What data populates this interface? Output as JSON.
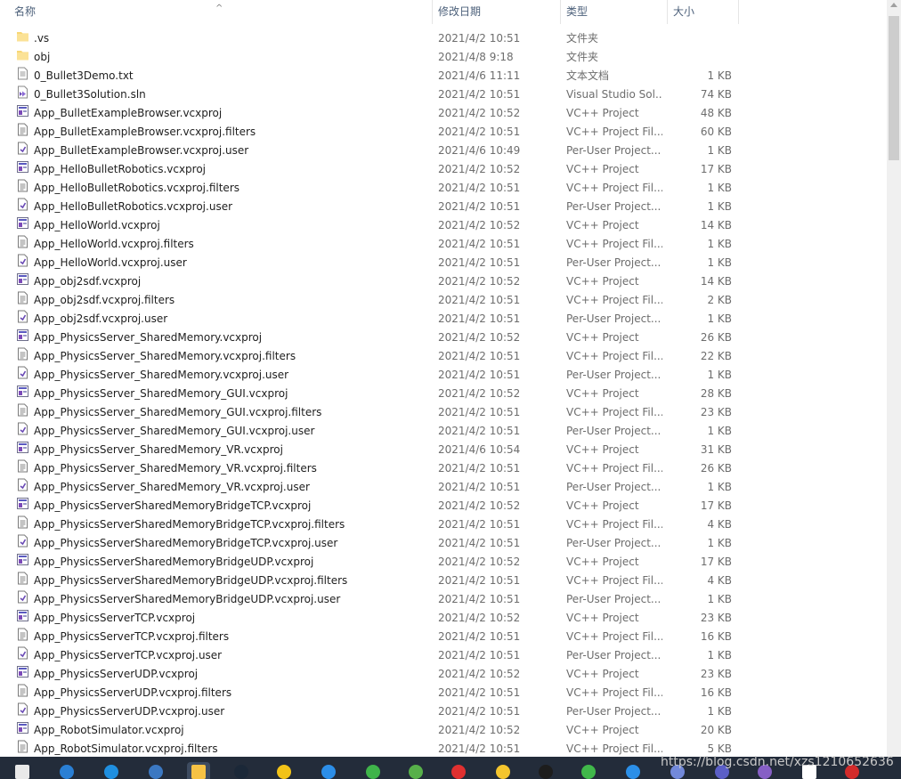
{
  "columns": {
    "name": "名称",
    "date": "修改日期",
    "type": "类型",
    "size": "大小"
  },
  "files": [
    {
      "name": ".vs",
      "date": "2021/4/2 10:51",
      "type": "文件夹",
      "size": "",
      "icon": "folder-icon"
    },
    {
      "name": "obj",
      "date": "2021/4/8 9:18",
      "type": "文件夹",
      "size": "",
      "icon": "folder-icon"
    },
    {
      "name": "0_Bullet3Demo.txt",
      "date": "2021/4/6 11:11",
      "type": "文本文档",
      "size": "1 KB",
      "icon": "text-file-icon"
    },
    {
      "name": "0_Bullet3Solution.sln",
      "date": "2021/4/2 10:51",
      "type": "Visual Studio Sol...",
      "size": "74 KB",
      "icon": "solution-file-icon"
    },
    {
      "name": "App_BulletExampleBrowser.vcxproj",
      "date": "2021/4/2 10:52",
      "type": "VC++ Project",
      "size": "48 KB",
      "icon": "vcxproj-file-icon"
    },
    {
      "name": "App_BulletExampleBrowser.vcxproj.filters",
      "date": "2021/4/2 10:51",
      "type": "VC++ Project Fil...",
      "size": "60 KB",
      "icon": "filters-file-icon"
    },
    {
      "name": "App_BulletExampleBrowser.vcxproj.user",
      "date": "2021/4/6 10:49",
      "type": "Per-User Project...",
      "size": "1 KB",
      "icon": "user-file-icon"
    },
    {
      "name": "App_HelloBulletRobotics.vcxproj",
      "date": "2021/4/2 10:52",
      "type": "VC++ Project",
      "size": "17 KB",
      "icon": "vcxproj-file-icon"
    },
    {
      "name": "App_HelloBulletRobotics.vcxproj.filters",
      "date": "2021/4/2 10:51",
      "type": "VC++ Project Fil...",
      "size": "1 KB",
      "icon": "filters-file-icon"
    },
    {
      "name": "App_HelloBulletRobotics.vcxproj.user",
      "date": "2021/4/2 10:51",
      "type": "Per-User Project...",
      "size": "1 KB",
      "icon": "user-file-icon"
    },
    {
      "name": "App_HelloWorld.vcxproj",
      "date": "2021/4/2 10:52",
      "type": "VC++ Project",
      "size": "14 KB",
      "icon": "vcxproj-file-icon"
    },
    {
      "name": "App_HelloWorld.vcxproj.filters",
      "date": "2021/4/2 10:51",
      "type": "VC++ Project Fil...",
      "size": "1 KB",
      "icon": "filters-file-icon"
    },
    {
      "name": "App_HelloWorld.vcxproj.user",
      "date": "2021/4/2 10:51",
      "type": "Per-User Project...",
      "size": "1 KB",
      "icon": "user-file-icon"
    },
    {
      "name": "App_obj2sdf.vcxproj",
      "date": "2021/4/2 10:52",
      "type": "VC++ Project",
      "size": "14 KB",
      "icon": "vcxproj-file-icon"
    },
    {
      "name": "App_obj2sdf.vcxproj.filters",
      "date": "2021/4/2 10:51",
      "type": "VC++ Project Fil...",
      "size": "2 KB",
      "icon": "filters-file-icon"
    },
    {
      "name": "App_obj2sdf.vcxproj.user",
      "date": "2021/4/2 10:51",
      "type": "Per-User Project...",
      "size": "1 KB",
      "icon": "user-file-icon"
    },
    {
      "name": "App_PhysicsServer_SharedMemory.vcxproj",
      "date": "2021/4/2 10:52",
      "type": "VC++ Project",
      "size": "26 KB",
      "icon": "vcxproj-file-icon"
    },
    {
      "name": "App_PhysicsServer_SharedMemory.vcxproj.filters",
      "date": "2021/4/2 10:51",
      "type": "VC++ Project Fil...",
      "size": "22 KB",
      "icon": "filters-file-icon"
    },
    {
      "name": "App_PhysicsServer_SharedMemory.vcxproj.user",
      "date": "2021/4/2 10:51",
      "type": "Per-User Project...",
      "size": "1 KB",
      "icon": "user-file-icon"
    },
    {
      "name": "App_PhysicsServer_SharedMemory_GUI.vcxproj",
      "date": "2021/4/2 10:52",
      "type": "VC++ Project",
      "size": "28 KB",
      "icon": "vcxproj-file-icon"
    },
    {
      "name": "App_PhysicsServer_SharedMemory_GUI.vcxproj.filters",
      "date": "2021/4/2 10:51",
      "type": "VC++ Project Fil...",
      "size": "23 KB",
      "icon": "filters-file-icon"
    },
    {
      "name": "App_PhysicsServer_SharedMemory_GUI.vcxproj.user",
      "date": "2021/4/2 10:51",
      "type": "Per-User Project...",
      "size": "1 KB",
      "icon": "user-file-icon"
    },
    {
      "name": "App_PhysicsServer_SharedMemory_VR.vcxproj",
      "date": "2021/4/6 10:54",
      "type": "VC++ Project",
      "size": "31 KB",
      "icon": "vcxproj-file-icon"
    },
    {
      "name": "App_PhysicsServer_SharedMemory_VR.vcxproj.filters",
      "date": "2021/4/2 10:51",
      "type": "VC++ Project Fil...",
      "size": "26 KB",
      "icon": "filters-file-icon"
    },
    {
      "name": "App_PhysicsServer_SharedMemory_VR.vcxproj.user",
      "date": "2021/4/2 10:51",
      "type": "Per-User Project...",
      "size": "1 KB",
      "icon": "user-file-icon"
    },
    {
      "name": "App_PhysicsServerSharedMemoryBridgeTCP.vcxproj",
      "date": "2021/4/2 10:52",
      "type": "VC++ Project",
      "size": "17 KB",
      "icon": "vcxproj-file-icon"
    },
    {
      "name": "App_PhysicsServerSharedMemoryBridgeTCP.vcxproj.filters",
      "date": "2021/4/2 10:51",
      "type": "VC++ Project Fil...",
      "size": "4 KB",
      "icon": "filters-file-icon"
    },
    {
      "name": "App_PhysicsServerSharedMemoryBridgeTCP.vcxproj.user",
      "date": "2021/4/2 10:51",
      "type": "Per-User Project...",
      "size": "1 KB",
      "icon": "user-file-icon"
    },
    {
      "name": "App_PhysicsServerSharedMemoryBridgeUDP.vcxproj",
      "date": "2021/4/2 10:52",
      "type": "VC++ Project",
      "size": "17 KB",
      "icon": "vcxproj-file-icon"
    },
    {
      "name": "App_PhysicsServerSharedMemoryBridgeUDP.vcxproj.filters",
      "date": "2021/4/2 10:51",
      "type": "VC++ Project Fil...",
      "size": "4 KB",
      "icon": "filters-file-icon"
    },
    {
      "name": "App_PhysicsServerSharedMemoryBridgeUDP.vcxproj.user",
      "date": "2021/4/2 10:51",
      "type": "Per-User Project...",
      "size": "1 KB",
      "icon": "user-file-icon"
    },
    {
      "name": "App_PhysicsServerTCP.vcxproj",
      "date": "2021/4/2 10:52",
      "type": "VC++ Project",
      "size": "23 KB",
      "icon": "vcxproj-file-icon"
    },
    {
      "name": "App_PhysicsServerTCP.vcxproj.filters",
      "date": "2021/4/2 10:51",
      "type": "VC++ Project Fil...",
      "size": "16 KB",
      "icon": "filters-file-icon"
    },
    {
      "name": "App_PhysicsServerTCP.vcxproj.user",
      "date": "2021/4/2 10:51",
      "type": "Per-User Project...",
      "size": "1 KB",
      "icon": "user-file-icon"
    },
    {
      "name": "App_PhysicsServerUDP.vcxproj",
      "date": "2021/4/2 10:52",
      "type": "VC++ Project",
      "size": "23 KB",
      "icon": "vcxproj-file-icon"
    },
    {
      "name": "App_PhysicsServerUDP.vcxproj.filters",
      "date": "2021/4/2 10:51",
      "type": "VC++ Project Fil...",
      "size": "16 KB",
      "icon": "filters-file-icon"
    },
    {
      "name": "App_PhysicsServerUDP.vcxproj.user",
      "date": "2021/4/2 10:51",
      "type": "Per-User Project...",
      "size": "1 KB",
      "icon": "user-file-icon"
    },
    {
      "name": "App_RobotSimulator.vcxproj",
      "date": "2021/4/2 10:52",
      "type": "VC++ Project",
      "size": "20 KB",
      "icon": "vcxproj-file-icon"
    },
    {
      "name": "App_RobotSimulator.vcxproj.filters",
      "date": "2021/4/2 10:51",
      "type": "VC++ Project Fil...",
      "size": "5 KB",
      "icon": "filters-file-icon"
    }
  ],
  "taskbar": {
    "icons": [
      {
        "name": "taskbar-store-icon",
        "color": "#e9e9e9"
      },
      {
        "name": "taskbar-app-icon",
        "color": "#2a7fd4"
      },
      {
        "name": "taskbar-mail-icon",
        "color": "#1f8fe0"
      },
      {
        "name": "taskbar-network-icon",
        "color": "#3b78c2"
      },
      {
        "name": "taskbar-file-explorer-icon",
        "color": "#f5c245"
      },
      {
        "name": "taskbar-steam-icon",
        "color": "#1b2838"
      },
      {
        "name": "taskbar-game-icon",
        "color": "#f2c318"
      },
      {
        "name": "taskbar-uplay-icon",
        "color": "#2c8ee8"
      },
      {
        "name": "taskbar-plus-icon",
        "color": "#3fb44a"
      },
      {
        "name": "taskbar-security-icon",
        "color": "#57b04a"
      },
      {
        "name": "taskbar-netease-music-icon",
        "color": "#e03030"
      },
      {
        "name": "taskbar-yellow-app-icon",
        "color": "#f4c52d"
      },
      {
        "name": "taskbar-qq-icon",
        "color": "#1d1d1d"
      },
      {
        "name": "taskbar-wechat-icon",
        "color": "#40b84a"
      },
      {
        "name": "taskbar-star-app-icon",
        "color": "#2b8fe8"
      },
      {
        "name": "taskbar-discord-icon",
        "color": "#7289da"
      },
      {
        "name": "taskbar-teams-icon",
        "color": "#5b5fc7"
      },
      {
        "name": "taskbar-visual-studio-icon",
        "color": "#865fc5"
      },
      {
        "name": "taskbar-blank-app-icon",
        "color": "#ffffff"
      },
      {
        "name": "taskbar-red-app-icon",
        "color": "#d22b2b"
      }
    ]
  },
  "watermark": "https://blog.csdn.net/xzs1210652636"
}
